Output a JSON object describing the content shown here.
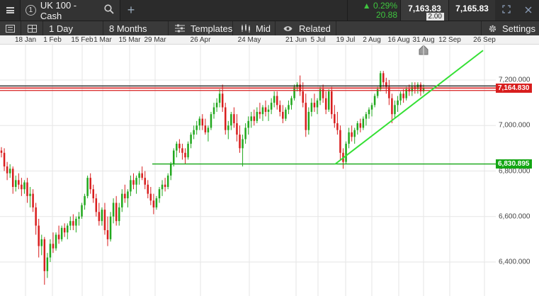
{
  "header": {
    "instrument_number": "1",
    "instrument_name": "UK 100 - Cash",
    "change_pct": "▲ 0.29%",
    "change_pts": "20.88",
    "sell_price": "7,163.83",
    "spread": "2.00",
    "buy_price": "7,165.83"
  },
  "toolbar": {
    "interval": "1 Day",
    "range": "8 Months",
    "templates": "Templates",
    "mid": "Mid",
    "related": "Related",
    "settings": "Settings"
  },
  "time_axis": [
    "18 Jan",
    "1 Feb",
    "15 Feb",
    "1 Mar",
    "15 Mar",
    "29 Mar",
    "26 Apr",
    "24 May",
    "21 Jun",
    "5 Jul",
    "19 Jul",
    "2 Aug",
    "16 Aug",
    "31 Aug",
    "12 Sep",
    "26 Sep"
  ],
  "price_axis": [
    "7,200.000",
    "7,000.000",
    "6,800.000",
    "6,600.000",
    "6,400.000"
  ],
  "price_tags": {
    "resistance": "7,164.830",
    "support": "6,830.895"
  },
  "colors": {
    "up": "#22a81e",
    "down": "#d81e1e",
    "resistance": "#d81e1e",
    "support": "#13a613",
    "trend": "#34e034"
  },
  "chart_data": {
    "type": "candlestick",
    "instrument": "UK 100 - Cash",
    "interval": "1 Day",
    "range": "8 Months",
    "ylim": [
      6270,
      7340
    ],
    "x_ticks": [
      "18 Jan",
      "1 Feb",
      "15 Feb",
      "1 Mar",
      "15 Mar",
      "29 Mar",
      "26 Apr",
      "24 May",
      "21 Jun",
      "5 Jul",
      "19 Jul",
      "2 Aug",
      "16 Aug",
      "31 Aug",
      "12 Sep",
      "26 Sep"
    ],
    "y_ticks": [
      7200,
      7000,
      6800,
      6600,
      6400
    ],
    "horizontal_lines": [
      {
        "name": "resistance-upper",
        "value": 7174,
        "color": "#111111"
      },
      {
        "name": "resistance",
        "value": 7164.83,
        "color": "#d81e1e"
      },
      {
        "name": "resistance-lower",
        "value": 7154,
        "color": "#d81e1e"
      },
      {
        "name": "support",
        "value": 6830.895,
        "color": "#13a613"
      }
    ],
    "trend_line": {
      "from": {
        "x": "19 Jul",
        "y": 6830
      },
      "to": {
        "x": "26 Sep",
        "y": 7330
      }
    },
    "candles": [
      {
        "o": 6890,
        "h": 6905,
        "l": 6860,
        "c": 6880
      },
      {
        "o": 6880,
        "h": 6900,
        "l": 6800,
        "c": 6820
      },
      {
        "o": 6820,
        "h": 6840,
        "l": 6760,
        "c": 6790
      },
      {
        "o": 6790,
        "h": 6830,
        "l": 6770,
        "c": 6810
      },
      {
        "o": 6810,
        "h": 6820,
        "l": 6700,
        "c": 6730
      },
      {
        "o": 6730,
        "h": 6780,
        "l": 6710,
        "c": 6760
      },
      {
        "o": 6760,
        "h": 6790,
        "l": 6720,
        "c": 6740
      },
      {
        "o": 6740,
        "h": 6770,
        "l": 6690,
        "c": 6720
      },
      {
        "o": 6720,
        "h": 6760,
        "l": 6700,
        "c": 6750
      },
      {
        "o": 6750,
        "h": 6770,
        "l": 6660,
        "c": 6690
      },
      {
        "o": 6690,
        "h": 6730,
        "l": 6640,
        "c": 6700
      },
      {
        "o": 6700,
        "h": 6720,
        "l": 6620,
        "c": 6640
      },
      {
        "o": 6640,
        "h": 6660,
        "l": 6520,
        "c": 6560
      },
      {
        "o": 6560,
        "h": 6590,
        "l": 6420,
        "c": 6470
      },
      {
        "o": 6470,
        "h": 6520,
        "l": 6430,
        "c": 6500
      },
      {
        "o": 6500,
        "h": 6510,
        "l": 6300,
        "c": 6360
      },
      {
        "o": 6360,
        "h": 6440,
        "l": 6330,
        "c": 6420
      },
      {
        "o": 6420,
        "h": 6500,
        "l": 6400,
        "c": 6480
      },
      {
        "o": 6480,
        "h": 6530,
        "l": 6440,
        "c": 6460
      },
      {
        "o": 6460,
        "h": 6530,
        "l": 6450,
        "c": 6520
      },
      {
        "o": 6520,
        "h": 6560,
        "l": 6480,
        "c": 6500
      },
      {
        "o": 6500,
        "h": 6560,
        "l": 6490,
        "c": 6550
      },
      {
        "o": 6550,
        "h": 6570,
        "l": 6510,
        "c": 6530
      },
      {
        "o": 6530,
        "h": 6570,
        "l": 6500,
        "c": 6560
      },
      {
        "o": 6560,
        "h": 6600,
        "l": 6540,
        "c": 6580
      },
      {
        "o": 6580,
        "h": 6610,
        "l": 6540,
        "c": 6560
      },
      {
        "o": 6560,
        "h": 6600,
        "l": 6530,
        "c": 6590
      },
      {
        "o": 6590,
        "h": 6620,
        "l": 6560,
        "c": 6600
      },
      {
        "o": 6600,
        "h": 6660,
        "l": 6590,
        "c": 6650
      },
      {
        "o": 6650,
        "h": 6700,
        "l": 6630,
        "c": 6690
      },
      {
        "o": 6690,
        "h": 6780,
        "l": 6680,
        "c": 6770
      },
      {
        "o": 6770,
        "h": 6790,
        "l": 6700,
        "c": 6720
      },
      {
        "o": 6720,
        "h": 6740,
        "l": 6660,
        "c": 6680
      },
      {
        "o": 6680,
        "h": 6700,
        "l": 6600,
        "c": 6620
      },
      {
        "o": 6620,
        "h": 6660,
        "l": 6560,
        "c": 6580
      },
      {
        "o": 6580,
        "h": 6640,
        "l": 6560,
        "c": 6630
      },
      {
        "o": 6630,
        "h": 6660,
        "l": 6520,
        "c": 6540
      },
      {
        "o": 6540,
        "h": 6600,
        "l": 6470,
        "c": 6500
      },
      {
        "o": 6500,
        "h": 6620,
        "l": 6490,
        "c": 6600
      },
      {
        "o": 6600,
        "h": 6680,
        "l": 6570,
        "c": 6660
      },
      {
        "o": 6660,
        "h": 6690,
        "l": 6560,
        "c": 6580
      },
      {
        "o": 6580,
        "h": 6660,
        "l": 6560,
        "c": 6640
      },
      {
        "o": 6640,
        "h": 6720,
        "l": 6620,
        "c": 6700
      },
      {
        "o": 6700,
        "h": 6740,
        "l": 6660,
        "c": 6680
      },
      {
        "o": 6680,
        "h": 6720,
        "l": 6640,
        "c": 6710
      },
      {
        "o": 6710,
        "h": 6780,
        "l": 6690,
        "c": 6760
      },
      {
        "o": 6760,
        "h": 6790,
        "l": 6720,
        "c": 6740
      },
      {
        "o": 6740,
        "h": 6780,
        "l": 6700,
        "c": 6770
      },
      {
        "o": 6770,
        "h": 6800,
        "l": 6740,
        "c": 6790
      },
      {
        "o": 6790,
        "h": 6820,
        "l": 6760,
        "c": 6770
      },
      {
        "o": 6770,
        "h": 6800,
        "l": 6720,
        "c": 6740
      },
      {
        "o": 6740,
        "h": 6760,
        "l": 6680,
        "c": 6700
      },
      {
        "o": 6700,
        "h": 6730,
        "l": 6650,
        "c": 6670
      },
      {
        "o": 6670,
        "h": 6700,
        "l": 6610,
        "c": 6640
      },
      {
        "o": 6640,
        "h": 6690,
        "l": 6630,
        "c": 6680
      },
      {
        "o": 6680,
        "h": 6730,
        "l": 6660,
        "c": 6720
      },
      {
        "o": 6720,
        "h": 6760,
        "l": 6690,
        "c": 6740
      },
      {
        "o": 6740,
        "h": 6770,
        "l": 6710,
        "c": 6730
      },
      {
        "o": 6730,
        "h": 6790,
        "l": 6720,
        "c": 6780
      },
      {
        "o": 6780,
        "h": 6840,
        "l": 6760,
        "c": 6830
      },
      {
        "o": 6830,
        "h": 6900,
        "l": 6820,
        "c": 6890
      },
      {
        "o": 6890,
        "h": 6930,
        "l": 6860,
        "c": 6920
      },
      {
        "o": 6920,
        "h": 6940,
        "l": 6880,
        "c": 6900
      },
      {
        "o": 6900,
        "h": 6920,
        "l": 6850,
        "c": 6880
      },
      {
        "o": 6880,
        "h": 6900,
        "l": 6830,
        "c": 6860
      },
      {
        "o": 6860,
        "h": 6930,
        "l": 6850,
        "c": 6920
      },
      {
        "o": 6920,
        "h": 6970,
        "l": 6900,
        "c": 6960
      },
      {
        "o": 6960,
        "h": 7000,
        "l": 6940,
        "c": 6980
      },
      {
        "o": 6980,
        "h": 7020,
        "l": 6960,
        "c": 7000
      },
      {
        "o": 7000,
        "h": 7040,
        "l": 6980,
        "c": 7030
      },
      {
        "o": 7030,
        "h": 7050,
        "l": 6980,
        "c": 7000
      },
      {
        "o": 7000,
        "h": 7030,
        "l": 6960,
        "c": 6970
      },
      {
        "o": 6970,
        "h": 7000,
        "l": 6930,
        "c": 6990
      },
      {
        "o": 6990,
        "h": 7060,
        "l": 6980,
        "c": 7050
      },
      {
        "o": 7050,
        "h": 7100,
        "l": 7030,
        "c": 7080
      },
      {
        "o": 7080,
        "h": 7120,
        "l": 7060,
        "c": 7100
      },
      {
        "o": 7100,
        "h": 7160,
        "l": 7080,
        "c": 7140
      },
      {
        "o": 7140,
        "h": 7180,
        "l": 7060,
        "c": 7080
      },
      {
        "o": 7080,
        "h": 7100,
        "l": 6960,
        "c": 6980
      },
      {
        "o": 6980,
        "h": 7020,
        "l": 6940,
        "c": 7000
      },
      {
        "o": 7000,
        "h": 7060,
        "l": 6980,
        "c": 7050
      },
      {
        "o": 7050,
        "h": 7080,
        "l": 6990,
        "c": 7010
      },
      {
        "o": 7010,
        "h": 7050,
        "l": 6930,
        "c": 6960
      },
      {
        "o": 6960,
        "h": 7000,
        "l": 6880,
        "c": 6900
      },
      {
        "o": 6900,
        "h": 6960,
        "l": 6820,
        "c": 6940
      },
      {
        "o": 6940,
        "h": 7010,
        "l": 6920,
        "c": 6990
      },
      {
        "o": 6990,
        "h": 7040,
        "l": 6960,
        "c": 7020
      },
      {
        "o": 7020,
        "h": 7060,
        "l": 6990,
        "c": 7040
      },
      {
        "o": 7040,
        "h": 7070,
        "l": 7000,
        "c": 7020
      },
      {
        "o": 7020,
        "h": 7080,
        "l": 7010,
        "c": 7060
      },
      {
        "o": 7060,
        "h": 7100,
        "l": 7030,
        "c": 7050
      },
      {
        "o": 7050,
        "h": 7090,
        "l": 7020,
        "c": 7080
      },
      {
        "o": 7080,
        "h": 7110,
        "l": 7040,
        "c": 7060
      },
      {
        "o": 7060,
        "h": 7090,
        "l": 7020,
        "c": 7070
      },
      {
        "o": 7070,
        "h": 7120,
        "l": 7050,
        "c": 7100
      },
      {
        "o": 7100,
        "h": 7150,
        "l": 7080,
        "c": 7130
      },
      {
        "o": 7130,
        "h": 7150,
        "l": 7070,
        "c": 7090
      },
      {
        "o": 7090,
        "h": 7110,
        "l": 7040,
        "c": 7060
      },
      {
        "o": 7060,
        "h": 7090,
        "l": 7010,
        "c": 7030
      },
      {
        "o": 7030,
        "h": 7080,
        "l": 7020,
        "c": 7070
      },
      {
        "o": 7070,
        "h": 7110,
        "l": 7050,
        "c": 7090
      },
      {
        "o": 7090,
        "h": 7130,
        "l": 7070,
        "c": 7120
      },
      {
        "o": 7120,
        "h": 7180,
        "l": 7110,
        "c": 7170
      },
      {
        "o": 7170,
        "h": 7190,
        "l": 7150,
        "c": 7180
      },
      {
        "o": 7180,
        "h": 7220,
        "l": 7130,
        "c": 7150
      },
      {
        "o": 7150,
        "h": 7190,
        "l": 7080,
        "c": 7100
      },
      {
        "o": 7100,
        "h": 7140,
        "l": 6950,
        "c": 6980
      },
      {
        "o": 6980,
        "h": 7080,
        "l": 6960,
        "c": 7060
      },
      {
        "o": 7060,
        "h": 7120,
        "l": 7040,
        "c": 7100
      },
      {
        "o": 7100,
        "h": 7140,
        "l": 7060,
        "c": 7080
      },
      {
        "o": 7080,
        "h": 7120,
        "l": 7050,
        "c": 7110
      },
      {
        "o": 7110,
        "h": 7170,
        "l": 7090,
        "c": 7160
      },
      {
        "o": 7160,
        "h": 7180,
        "l": 7100,
        "c": 7120
      },
      {
        "o": 7120,
        "h": 7150,
        "l": 7050,
        "c": 7070
      },
      {
        "o": 7070,
        "h": 7160,
        "l": 7060,
        "c": 7150
      },
      {
        "o": 7150,
        "h": 7170,
        "l": 7030,
        "c": 7050
      },
      {
        "o": 7050,
        "h": 7090,
        "l": 6990,
        "c": 7010
      },
      {
        "o": 7010,
        "h": 7060,
        "l": 6960,
        "c": 6980
      },
      {
        "o": 6980,
        "h": 7000,
        "l": 6850,
        "c": 6880
      },
      {
        "o": 6880,
        "h": 6900,
        "l": 6810,
        "c": 6840
      },
      {
        "o": 6840,
        "h": 6930,
        "l": 6830,
        "c": 6920
      },
      {
        "o": 6920,
        "h": 6990,
        "l": 6900,
        "c": 6970
      },
      {
        "o": 6970,
        "h": 7000,
        "l": 6930,
        "c": 6950
      },
      {
        "o": 6950,
        "h": 6990,
        "l": 6920,
        "c": 6980
      },
      {
        "o": 6980,
        "h": 7020,
        "l": 6960,
        "c": 7010
      },
      {
        "o": 7010,
        "h": 7030,
        "l": 6970,
        "c": 6990
      },
      {
        "o": 6990,
        "h": 7040,
        "l": 6980,
        "c": 7030
      },
      {
        "o": 7030,
        "h": 7060,
        "l": 7000,
        "c": 7050
      },
      {
        "o": 7050,
        "h": 7080,
        "l": 7030,
        "c": 7070
      },
      {
        "o": 7070,
        "h": 7100,
        "l": 7040,
        "c": 7090
      },
      {
        "o": 7090,
        "h": 7140,
        "l": 7080,
        "c": 7130
      },
      {
        "o": 7130,
        "h": 7170,
        "l": 7120,
        "c": 7160
      },
      {
        "o": 7160,
        "h": 7240,
        "l": 7150,
        "c": 7230
      },
      {
        "o": 7230,
        "h": 7240,
        "l": 7170,
        "c": 7190
      },
      {
        "o": 7190,
        "h": 7210,
        "l": 7140,
        "c": 7170
      },
      {
        "o": 7170,
        "h": 7200,
        "l": 7090,
        "c": 7120
      },
      {
        "o": 7120,
        "h": 7140,
        "l": 7010,
        "c": 7050
      },
      {
        "o": 7050,
        "h": 7110,
        "l": 7030,
        "c": 7090
      },
      {
        "o": 7090,
        "h": 7130,
        "l": 7060,
        "c": 7110
      },
      {
        "o": 7110,
        "h": 7150,
        "l": 7090,
        "c": 7140
      },
      {
        "o": 7140,
        "h": 7160,
        "l": 7100,
        "c": 7120
      },
      {
        "o": 7120,
        "h": 7170,
        "l": 7110,
        "c": 7160
      },
      {
        "o": 7160,
        "h": 7180,
        "l": 7130,
        "c": 7150
      },
      {
        "o": 7150,
        "h": 7190,
        "l": 7130,
        "c": 7170
      },
      {
        "o": 7170,
        "h": 7190,
        "l": 7140,
        "c": 7160
      },
      {
        "o": 7160,
        "h": 7190,
        "l": 7140,
        "c": 7180
      },
      {
        "o": 7180,
        "h": 7190,
        "l": 7130,
        "c": 7150
      },
      {
        "o": 7150,
        "h": 7180,
        "l": 7140,
        "c": 7165
      }
    ]
  }
}
